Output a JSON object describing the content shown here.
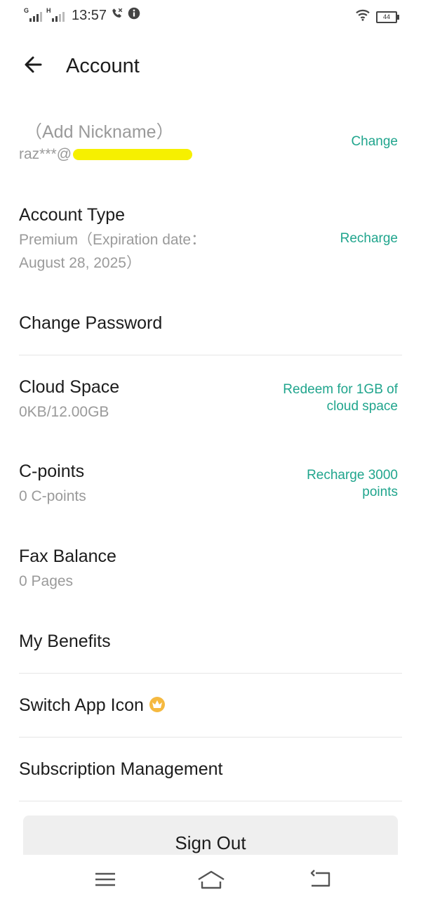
{
  "status_bar": {
    "sim1": "G",
    "sim2": "H",
    "time": "13:57",
    "battery": "44",
    "icons": [
      "signal-icon",
      "call-icon",
      "info-icon",
      "wifi-icon",
      "battery-icon"
    ]
  },
  "header": {
    "title": "Account"
  },
  "profile": {
    "nickname": "（Add Nickname）",
    "email_prefix": "raz***@",
    "change_label": "Change"
  },
  "account_type": {
    "label": "Account Type",
    "value_line1": "Premium（Expiration date：",
    "value_line2": "August 28, 2025）",
    "action": "Recharge"
  },
  "change_password": {
    "label": "Change Password"
  },
  "cloud_space": {
    "label": "Cloud Space",
    "value": "0KB/12.00GB",
    "action_line1": "Redeem for 1GB of",
    "action_line2": "cloud space"
  },
  "c_points": {
    "label": "C-points",
    "value": "0 C-points",
    "action_line1": "Recharge 3000",
    "action_line2": "points"
  },
  "fax_balance": {
    "label": "Fax Balance",
    "value": "0 Pages"
  },
  "my_benefits": {
    "label": "My Benefits"
  },
  "switch_app_icon": {
    "label": "Switch App Icon",
    "badge_icon": "crown-icon"
  },
  "subscription": {
    "label": "Subscription Management"
  },
  "sign_out": {
    "label": "Sign Out"
  },
  "colors": {
    "accent": "#20a58d",
    "secondary_text": "#9a9a9a",
    "highlight": "#f6f000"
  }
}
